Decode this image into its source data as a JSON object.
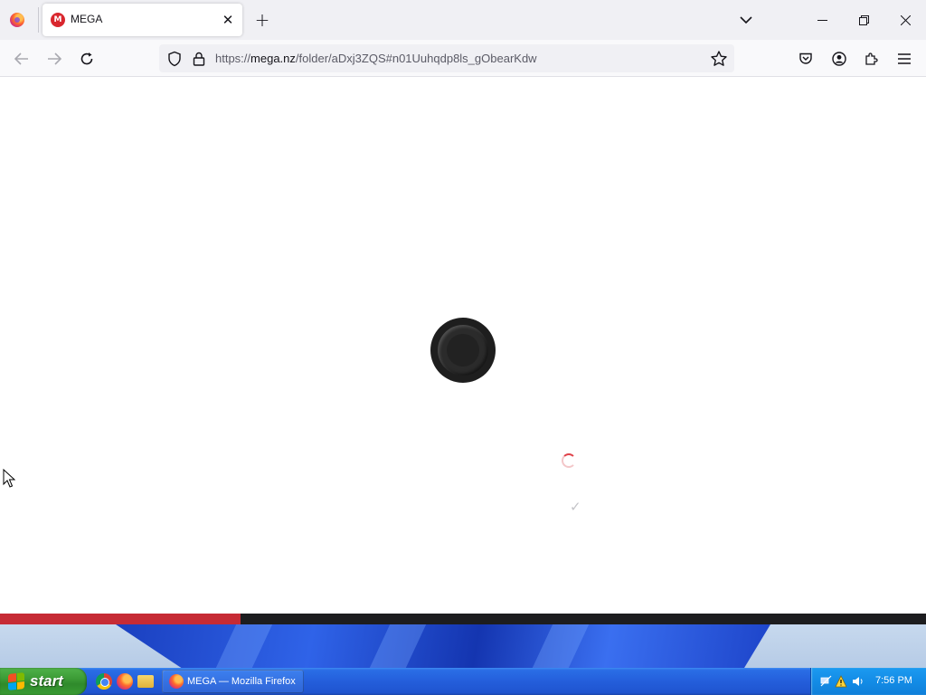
{
  "browser": {
    "tab": {
      "title": "MEGA",
      "favicon_letter": "M",
      "close_glyph": "✕"
    },
    "new_tab_glyph": "+",
    "window_controls": {
      "minimize": "—",
      "maximize": "❐",
      "close": "✕"
    },
    "nav": {
      "back": "←",
      "forward": "→",
      "reload": "↻"
    },
    "url": {
      "scheme": "https://",
      "host": "mega.nz",
      "path": "/folder/aDxj3ZQS#n01Uuhqdp8ls_gObearKdw"
    }
  },
  "page": {
    "checkmark": "✓",
    "progress_fraction": 0.26
  },
  "taskbar": {
    "start_label": "start",
    "task_button_label": "MEGA — Mozilla Firefox",
    "clock": "7:56 PM"
  },
  "colors": {
    "mega_red": "#d9272e",
    "progress_red": "#c62b35",
    "xp_flag": [
      "#f25022",
      "#7fba00",
      "#00a4ef",
      "#ffb900"
    ]
  },
  "icons": {
    "firefox_menu": "firefox-icon",
    "tracking": "shield-icon",
    "security": "lock-icon",
    "bookmark": "star-icon",
    "pocket": "pocket-icon",
    "account": "account-icon",
    "extensions": "puzzle-icon",
    "app_menu": "hamburger-icon"
  }
}
